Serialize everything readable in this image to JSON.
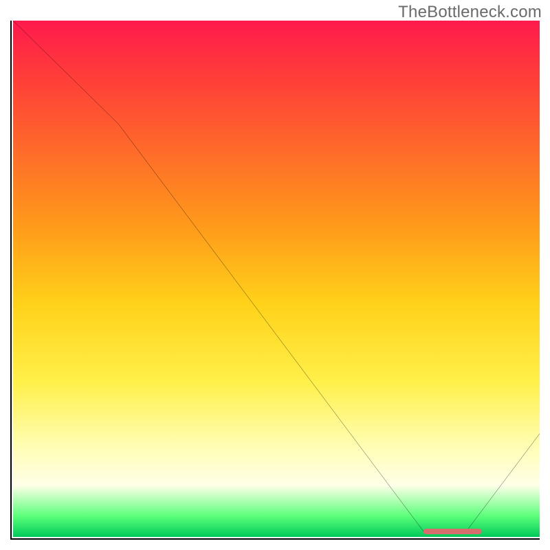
{
  "watermark": "TheBottleneck.com",
  "colors": {
    "gradient_top": "#ff1a4d",
    "gradient_mid": "#ffd21a",
    "gradient_bottom": "#00c95a",
    "curve": "#000000",
    "marker": "#d66e6e"
  },
  "chart_data": {
    "type": "line",
    "title": "",
    "xlabel": "",
    "ylabel": "",
    "xlim": [
      0,
      100
    ],
    "ylim": [
      0,
      100
    ],
    "series": [
      {
        "name": "bottleneck-curve",
        "x": [
          0,
          20,
          78,
          86,
          100
        ],
        "values": [
          100,
          80,
          1,
          1,
          20
        ]
      }
    ],
    "annotations": [
      {
        "name": "optimal-range-marker",
        "x_start": 78,
        "x_end": 89,
        "y": 1
      }
    ]
  }
}
